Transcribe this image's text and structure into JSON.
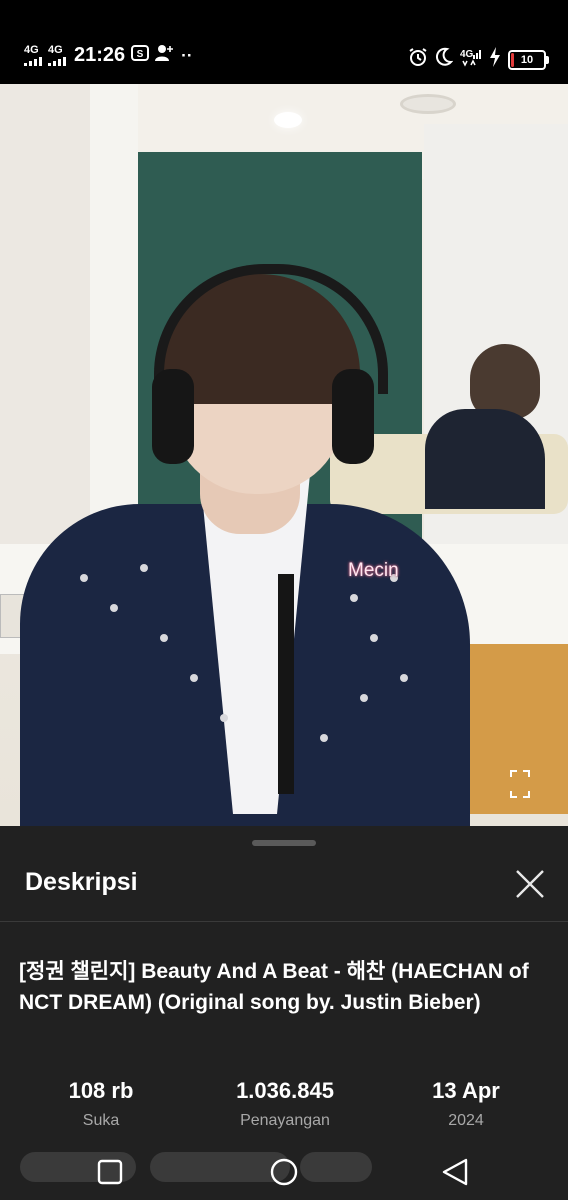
{
  "status_bar": {
    "network1": "4G",
    "network2": "4G",
    "time": "21:26",
    "notif_icons": [
      "video-icon",
      "person-add-icon"
    ],
    "overflow": "··",
    "right_icons": [
      "alarm-icon",
      "moon-icon",
      "4g-signal-icon",
      "charging-bolt-icon"
    ],
    "battery_level": "10",
    "battery_fraction": 0.1,
    "battery_color": "#e23b3b"
  },
  "video": {
    "watermark": "Mecin",
    "fullscreen_icon": "fullscreen-icon"
  },
  "description": {
    "heading": "Deskripsi",
    "close_icon": "close-icon",
    "title": "[정권 챌린지] Beauty And A Beat - 해찬 (HAECHAN of NCT DREAM) (Original song by. Justin Bieber)",
    "stats": [
      {
        "value": "108 rb",
        "label": "Suka"
      },
      {
        "value": "1.036.845",
        "label": "Penayangan"
      },
      {
        "value": "13 Apr",
        "label": "2024"
      }
    ]
  },
  "nav_bar": {
    "buttons": [
      "recents-square-icon",
      "home-circle-icon",
      "back-triangle-icon"
    ]
  },
  "colors": {
    "sheet_bg": "#212121",
    "page_bg": "#000000",
    "wall_green": "#2f5c52",
    "jacket_navy": "#1b2642"
  }
}
